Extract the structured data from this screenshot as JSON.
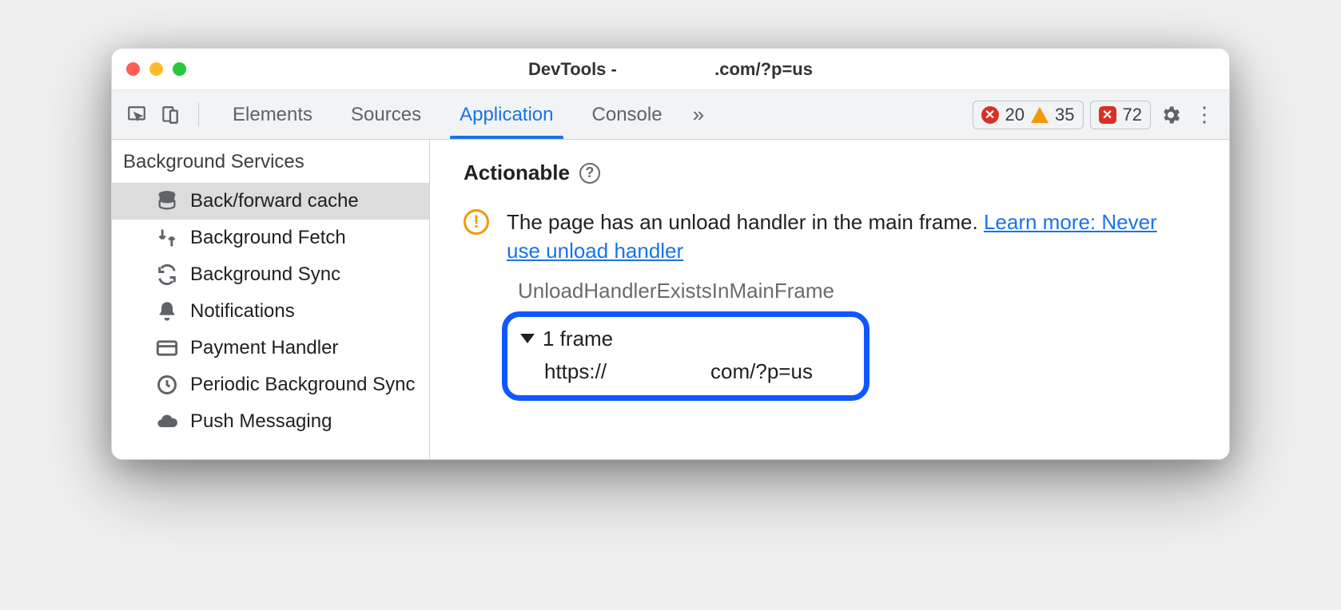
{
  "window": {
    "title_prefix": "DevTools - ",
    "title_url_suffix": ".com/?p=us"
  },
  "toolbar": {
    "tabs": [
      "Elements",
      "Sources",
      "Application",
      "Console"
    ],
    "active_tab": "Application",
    "more_indicator": "»",
    "errors": "20",
    "warnings": "35",
    "issues": "72"
  },
  "sidebar": {
    "section": "Background Services",
    "items": [
      {
        "label": "Back/forward cache",
        "icon": "database",
        "selected": true
      },
      {
        "label": "Background Fetch",
        "icon": "fetch",
        "selected": false
      },
      {
        "label": "Background Sync",
        "icon": "sync",
        "selected": false
      },
      {
        "label": "Notifications",
        "icon": "bell",
        "selected": false
      },
      {
        "label": "Payment Handler",
        "icon": "card",
        "selected": false
      },
      {
        "label": "Periodic Background Sync",
        "icon": "clock",
        "selected": false
      },
      {
        "label": "Push Messaging",
        "icon": "cloud",
        "selected": false
      }
    ]
  },
  "main": {
    "section_title": "Actionable",
    "issue_text": "The page has an unload handler in the main frame. ",
    "issue_link": "Learn more: Never use unload handler",
    "reason_code": "UnloadHandlerExistsInMainFrame",
    "frame_summary": "1 frame",
    "frame_url_prefix": "https://",
    "frame_url_suffix": "com/?p=us"
  }
}
